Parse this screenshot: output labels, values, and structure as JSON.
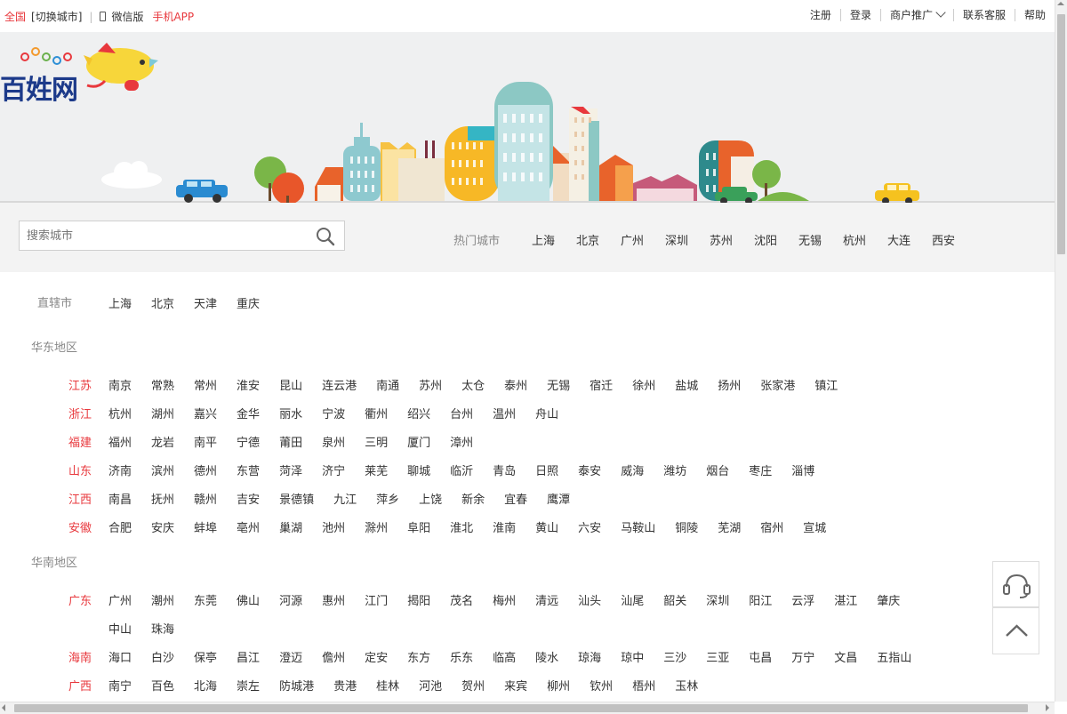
{
  "topbar": {
    "location": "全国",
    "switch_city": "[切换城市]",
    "wechat": "微信版",
    "mobile_app": "手机APP",
    "register": "注册",
    "login": "登录",
    "merchant": "商户推广",
    "contact": "联系客服",
    "help": "帮助"
  },
  "logo": {
    "text": "百姓网"
  },
  "search": {
    "placeholder": "搜索城市"
  },
  "hot": {
    "label": "热门城市",
    "cities": [
      "上海",
      "北京",
      "广州",
      "深圳",
      "苏州",
      "沈阳",
      "无锡",
      "杭州",
      "大连",
      "西安"
    ]
  },
  "municipalities": {
    "label": "直辖市",
    "cities": [
      "上海",
      "北京",
      "天津",
      "重庆"
    ]
  },
  "east": {
    "label": "华东地区",
    "provinces": [
      {
        "name": "江苏",
        "cities": [
          "南京",
          "常熟",
          "常州",
          "淮安",
          "昆山",
          "连云港",
          "南通",
          "苏州",
          "太仓",
          "泰州",
          "无锡",
          "宿迁",
          "徐州",
          "盐城",
          "扬州",
          "张家港",
          "镇江"
        ]
      },
      {
        "name": "浙江",
        "cities": [
          "杭州",
          "湖州",
          "嘉兴",
          "金华",
          "丽水",
          "宁波",
          "衢州",
          "绍兴",
          "台州",
          "温州",
          "舟山"
        ]
      },
      {
        "name": "福建",
        "cities": [
          "福州",
          "龙岩",
          "南平",
          "宁德",
          "莆田",
          "泉州",
          "三明",
          "厦门",
          "漳州"
        ]
      },
      {
        "name": "山东",
        "cities": [
          "济南",
          "滨州",
          "德州",
          "东营",
          "菏泽",
          "济宁",
          "莱芜",
          "聊城",
          "临沂",
          "青岛",
          "日照",
          "泰安",
          "威海",
          "潍坊",
          "烟台",
          "枣庄",
          "淄博"
        ]
      },
      {
        "name": "江西",
        "cities": [
          "南昌",
          "抚州",
          "赣州",
          "吉安",
          "景德镇",
          "九江",
          "萍乡",
          "上饶",
          "新余",
          "宜春",
          "鹰潭"
        ]
      },
      {
        "name": "安徽",
        "cities": [
          "合肥",
          "安庆",
          "蚌埠",
          "亳州",
          "巢湖",
          "池州",
          "滁州",
          "阜阳",
          "淮北",
          "淮南",
          "黄山",
          "六安",
          "马鞍山",
          "铜陵",
          "芜湖",
          "宿州",
          "宣城"
        ]
      }
    ]
  },
  "south": {
    "label": "华南地区",
    "provinces": [
      {
        "name": "广东",
        "cities": [
          "广州",
          "潮州",
          "东莞",
          "佛山",
          "河源",
          "惠州",
          "江门",
          "揭阳",
          "茂名",
          "梅州",
          "清远",
          "汕头",
          "汕尾",
          "韶关",
          "深圳",
          "阳江",
          "云浮",
          "湛江",
          "肇庆"
        ],
        "cities2": [
          "中山",
          "珠海"
        ]
      },
      {
        "name": "海南",
        "cities": [
          "海口",
          "白沙",
          "保亭",
          "昌江",
          "澄迈",
          "儋州",
          "定安",
          "东方",
          "乐东",
          "临高",
          "陵水",
          "琼海",
          "琼中",
          "三沙",
          "三亚",
          "屯昌",
          "万宁",
          "文昌",
          "五指山"
        ]
      },
      {
        "name": "广西",
        "cities": [
          "南宁",
          "百色",
          "北海",
          "崇左",
          "防城港",
          "贵港",
          "桂林",
          "河池",
          "贺州",
          "来宾",
          "柳州",
          "钦州",
          "梧州",
          "玉林"
        ]
      }
    ]
  },
  "colors": {
    "accent": "#e8383d",
    "banner_bg": "#eff0f1",
    "logo": "#1c3a8a"
  },
  "icons": {
    "support": "headset-icon",
    "top": "chevron-up-icon",
    "search": "search-icon"
  }
}
